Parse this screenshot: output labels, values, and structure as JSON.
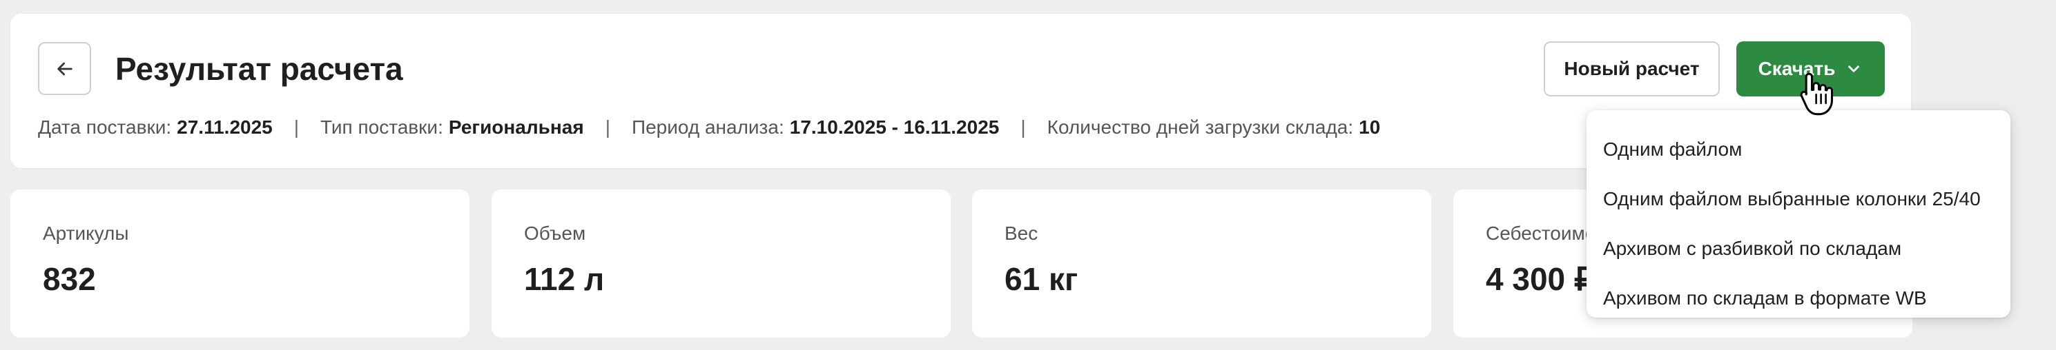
{
  "header": {
    "title": "Результат расчета",
    "back_icon": "arrow-left-icon",
    "new_calc_label": "Новый расчет",
    "download_label": "Скачать",
    "download_icon": "chevron-down-icon",
    "accent_color": "#2d8a41"
  },
  "meta": {
    "delivery_date_label": "Дата поставки:",
    "delivery_date_value": "27.11.2025",
    "delivery_type_label": "Тип поставки:",
    "delivery_type_value": "Региональная",
    "period_label": "Период анализа:",
    "period_value": "17.10.2025 - 16.11.2025",
    "days_label": "Количество дней загрузки склада:",
    "days_value": "10",
    "separator": "|"
  },
  "stats": [
    {
      "label": "Артикулы",
      "value": "832"
    },
    {
      "label": "Объем",
      "value": "112 л"
    },
    {
      "label": "Вес",
      "value": "61 кг"
    },
    {
      "label": "Себестоимо",
      "value": "4 300 ₽"
    }
  ],
  "download_menu": {
    "items": [
      {
        "label": "Одним файлом"
      },
      {
        "label": "Одним файлом выбранные колонки 25/40"
      },
      {
        "label": "Архивом с разбивкой по складам"
      },
      {
        "label": "Архивом по складам в формате WB"
      }
    ]
  },
  "cursor_icon": "hand-pointer-icon"
}
